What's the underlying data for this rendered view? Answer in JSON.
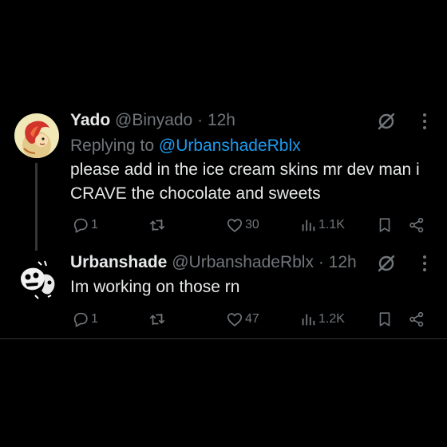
{
  "tweets": [
    {
      "name": "Yado",
      "handle": "@Binyado",
      "separator": "·",
      "time": "12h",
      "replying_prefix": "Replying to ",
      "replying_to": "@UrbanshadeRblx",
      "text_line1": "please add in the ice cream skins mr dev man i",
      "text_line2": "CRAVE the chocolate and sweets",
      "replies": "1",
      "likes": "30",
      "views": "1.1K"
    },
    {
      "name": "Urbanshade",
      "handle": "@UrbanshadeRblx",
      "separator": "·",
      "time": "12h",
      "text_line1": "Im working on those rn",
      "replies": "1",
      "likes": "47",
      "views": "1.2K"
    }
  ],
  "colors": {
    "background": "#000000",
    "text": "#e7e9ea",
    "muted": "#71767b",
    "link": "#1d9bf0",
    "divider": "#2f3336"
  }
}
